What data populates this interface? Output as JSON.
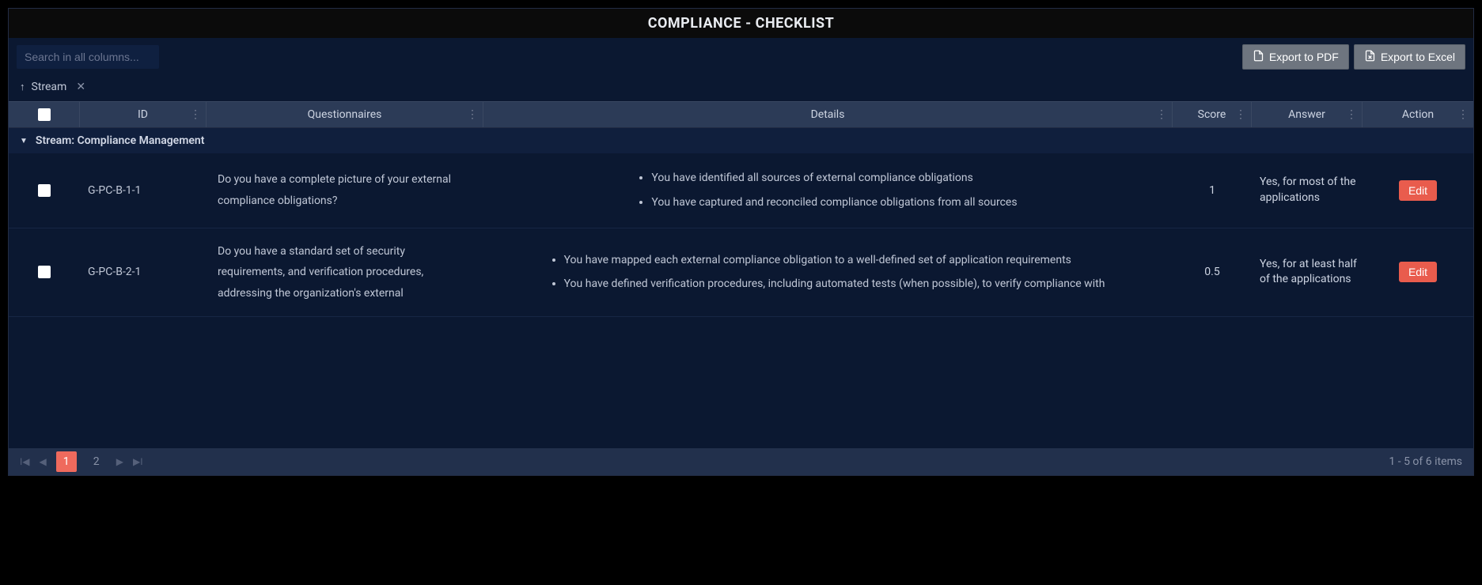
{
  "title": "COMPLIANCE - CHECKLIST",
  "search": {
    "placeholder": "Search in all columns..."
  },
  "export": {
    "pdf_label": "Export to PDF",
    "excel_label": "Export to Excel"
  },
  "grouping": {
    "field": "Stream"
  },
  "columns": {
    "id": "ID",
    "questionnaires": "Questionnaires",
    "details": "Details",
    "score": "Score",
    "answer": "Answer",
    "action": "Action"
  },
  "group": {
    "label": "Stream: Compliance Management"
  },
  "rows": [
    {
      "id": "G-PC-B-1-1",
      "question": "Do you have a complete picture of your external compliance obligations?",
      "details": [
        "You have identified all sources of external compliance obligations",
        "You have captured and reconciled compliance obligations from all sources"
      ],
      "score": "1",
      "answer": "Yes, for most of the applications",
      "action_label": "Edit"
    },
    {
      "id": "G-PC-B-2-1",
      "question": "Do you have a standard set of security requirements, and verification procedures, addressing the organization's external",
      "details": [
        "You have mapped each external compliance obligation to a well-defined set of application requirements",
        "You have defined verification procedures, including automated tests (when possible), to verify compliance with"
      ],
      "score": "0.5",
      "answer": "Yes, for at least half of the applications",
      "action_label": "Edit"
    }
  ],
  "pager": {
    "pages": [
      "1",
      "2"
    ],
    "current": "1",
    "summary": "1 - 5 of 6 items"
  }
}
